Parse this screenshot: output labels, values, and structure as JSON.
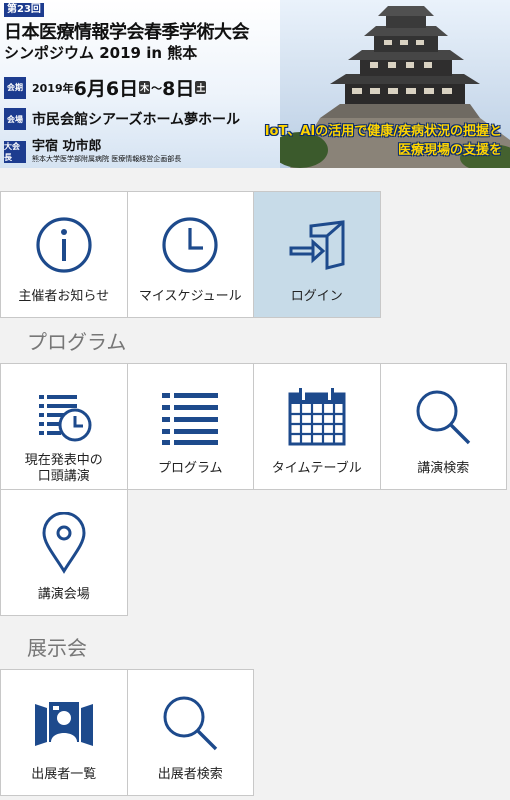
{
  "banner": {
    "edition": "第23回",
    "title": "日本医療情報学会春季学術大会",
    "subtitle": "シンポジウム 2019 in 熊本",
    "date_tag": "会期",
    "date_year": "2019年",
    "date_month1": "6月",
    "date_day1": "6日",
    "date_dow1": "木",
    "date_tilde": "～",
    "date_day2": "8日",
    "date_dow2": "土",
    "venue_tag": "会場",
    "venue": "市民会館シアーズホーム夢ホール",
    "chair_tag": "大会長",
    "chair_name": "宇宿 功市郎",
    "chair_affiliation": "熊本大学医学部附属病院 医療情報経営企画部長",
    "slogan_line1": "IoT、AIの活用で健康/疾病状況の把握と",
    "slogan_line2": "医療現場の支援を",
    "colors": {
      "navy": "#1d3c8f",
      "slogan": "#ffd400"
    }
  },
  "top_menu": [
    {
      "label": "主催者お知らせ",
      "icon": "info-icon"
    },
    {
      "label": "マイスケジュール",
      "icon": "clock-icon"
    },
    {
      "label": "ログイン",
      "icon": "login-icon",
      "active": true
    }
  ],
  "program_section": {
    "title": "プログラム",
    "items": [
      {
        "label_line1": "現在発表中の",
        "label_line2": "口頭講演",
        "icon": "current-talks-icon"
      },
      {
        "label": "プログラム",
        "icon": "list-icon"
      },
      {
        "label": "タイムテーブル",
        "icon": "calendar-icon"
      },
      {
        "label": "講演検索",
        "icon": "search-icon"
      },
      {
        "label": "講演会場",
        "icon": "map-pin-icon"
      }
    ]
  },
  "exhibition_section": {
    "title": "展示会",
    "items": [
      {
        "label": "出展者一覧",
        "icon": "exhibitor-icon"
      },
      {
        "label": "出展者検索",
        "icon": "search-icon"
      }
    ]
  },
  "icon_color": "#1d4a8c",
  "active_tile_color": "#c7dbe8"
}
